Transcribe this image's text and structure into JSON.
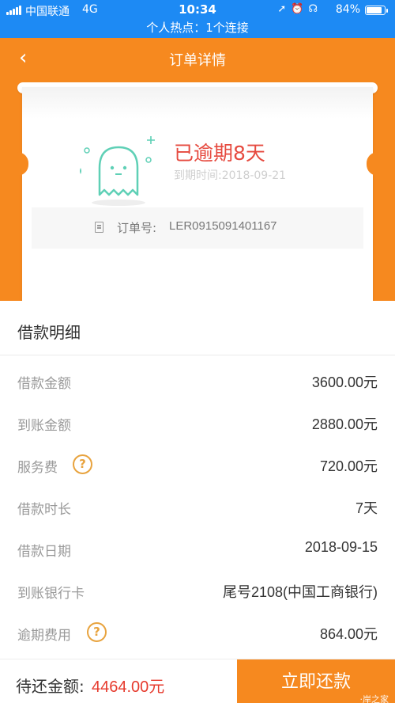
{
  "status_bar": {
    "carrier": "中国联通",
    "network": "4G",
    "time": "10:34",
    "battery": "84%",
    "battery_level": 0.84,
    "icons": [
      "location-arrow-icon",
      "alarm-icon",
      "headphones-icon"
    ]
  },
  "hotspot_bar": {
    "text": "个人热点：1个连接"
  },
  "header": {
    "back_icon": "chevron-left-icon",
    "title": "订单详情",
    "background": "#f6891f"
  },
  "order_status": {
    "status": "已逾期8天",
    "due_date": "到期时间:2018-09-21",
    "order_label": "订单号:",
    "order_no": "LER0915091401167",
    "status_color": "#e64a3f"
  },
  "details": {
    "heading": "借款明细",
    "rows": [
      {
        "label": "借款金额",
        "value": "3600.00元",
        "help": false
      },
      {
        "label": "到账金额",
        "value": "2880.00元",
        "help": false
      },
      {
        "label": "服务费",
        "value": "720.00元",
        "help": true
      },
      {
        "label": "借款时长",
        "value": "7天",
        "help": false
      },
      {
        "label": "借款日期",
        "value": "2018-09-15",
        "help": false
      },
      {
        "label": "到账银行卡",
        "value": "尾号2108(中国工商银行)",
        "help": false
      },
      {
        "label": "逾期费用",
        "value": "864.00元",
        "help": true
      }
    ],
    "help_symbol": "?"
  },
  "footer": {
    "label": "待还金额:",
    "amount": "4464.00元",
    "repay_button": "立即还款",
    "watermark": "·岸之家",
    "amount_color": "#e63a2d",
    "button_color": "#f6891f"
  }
}
